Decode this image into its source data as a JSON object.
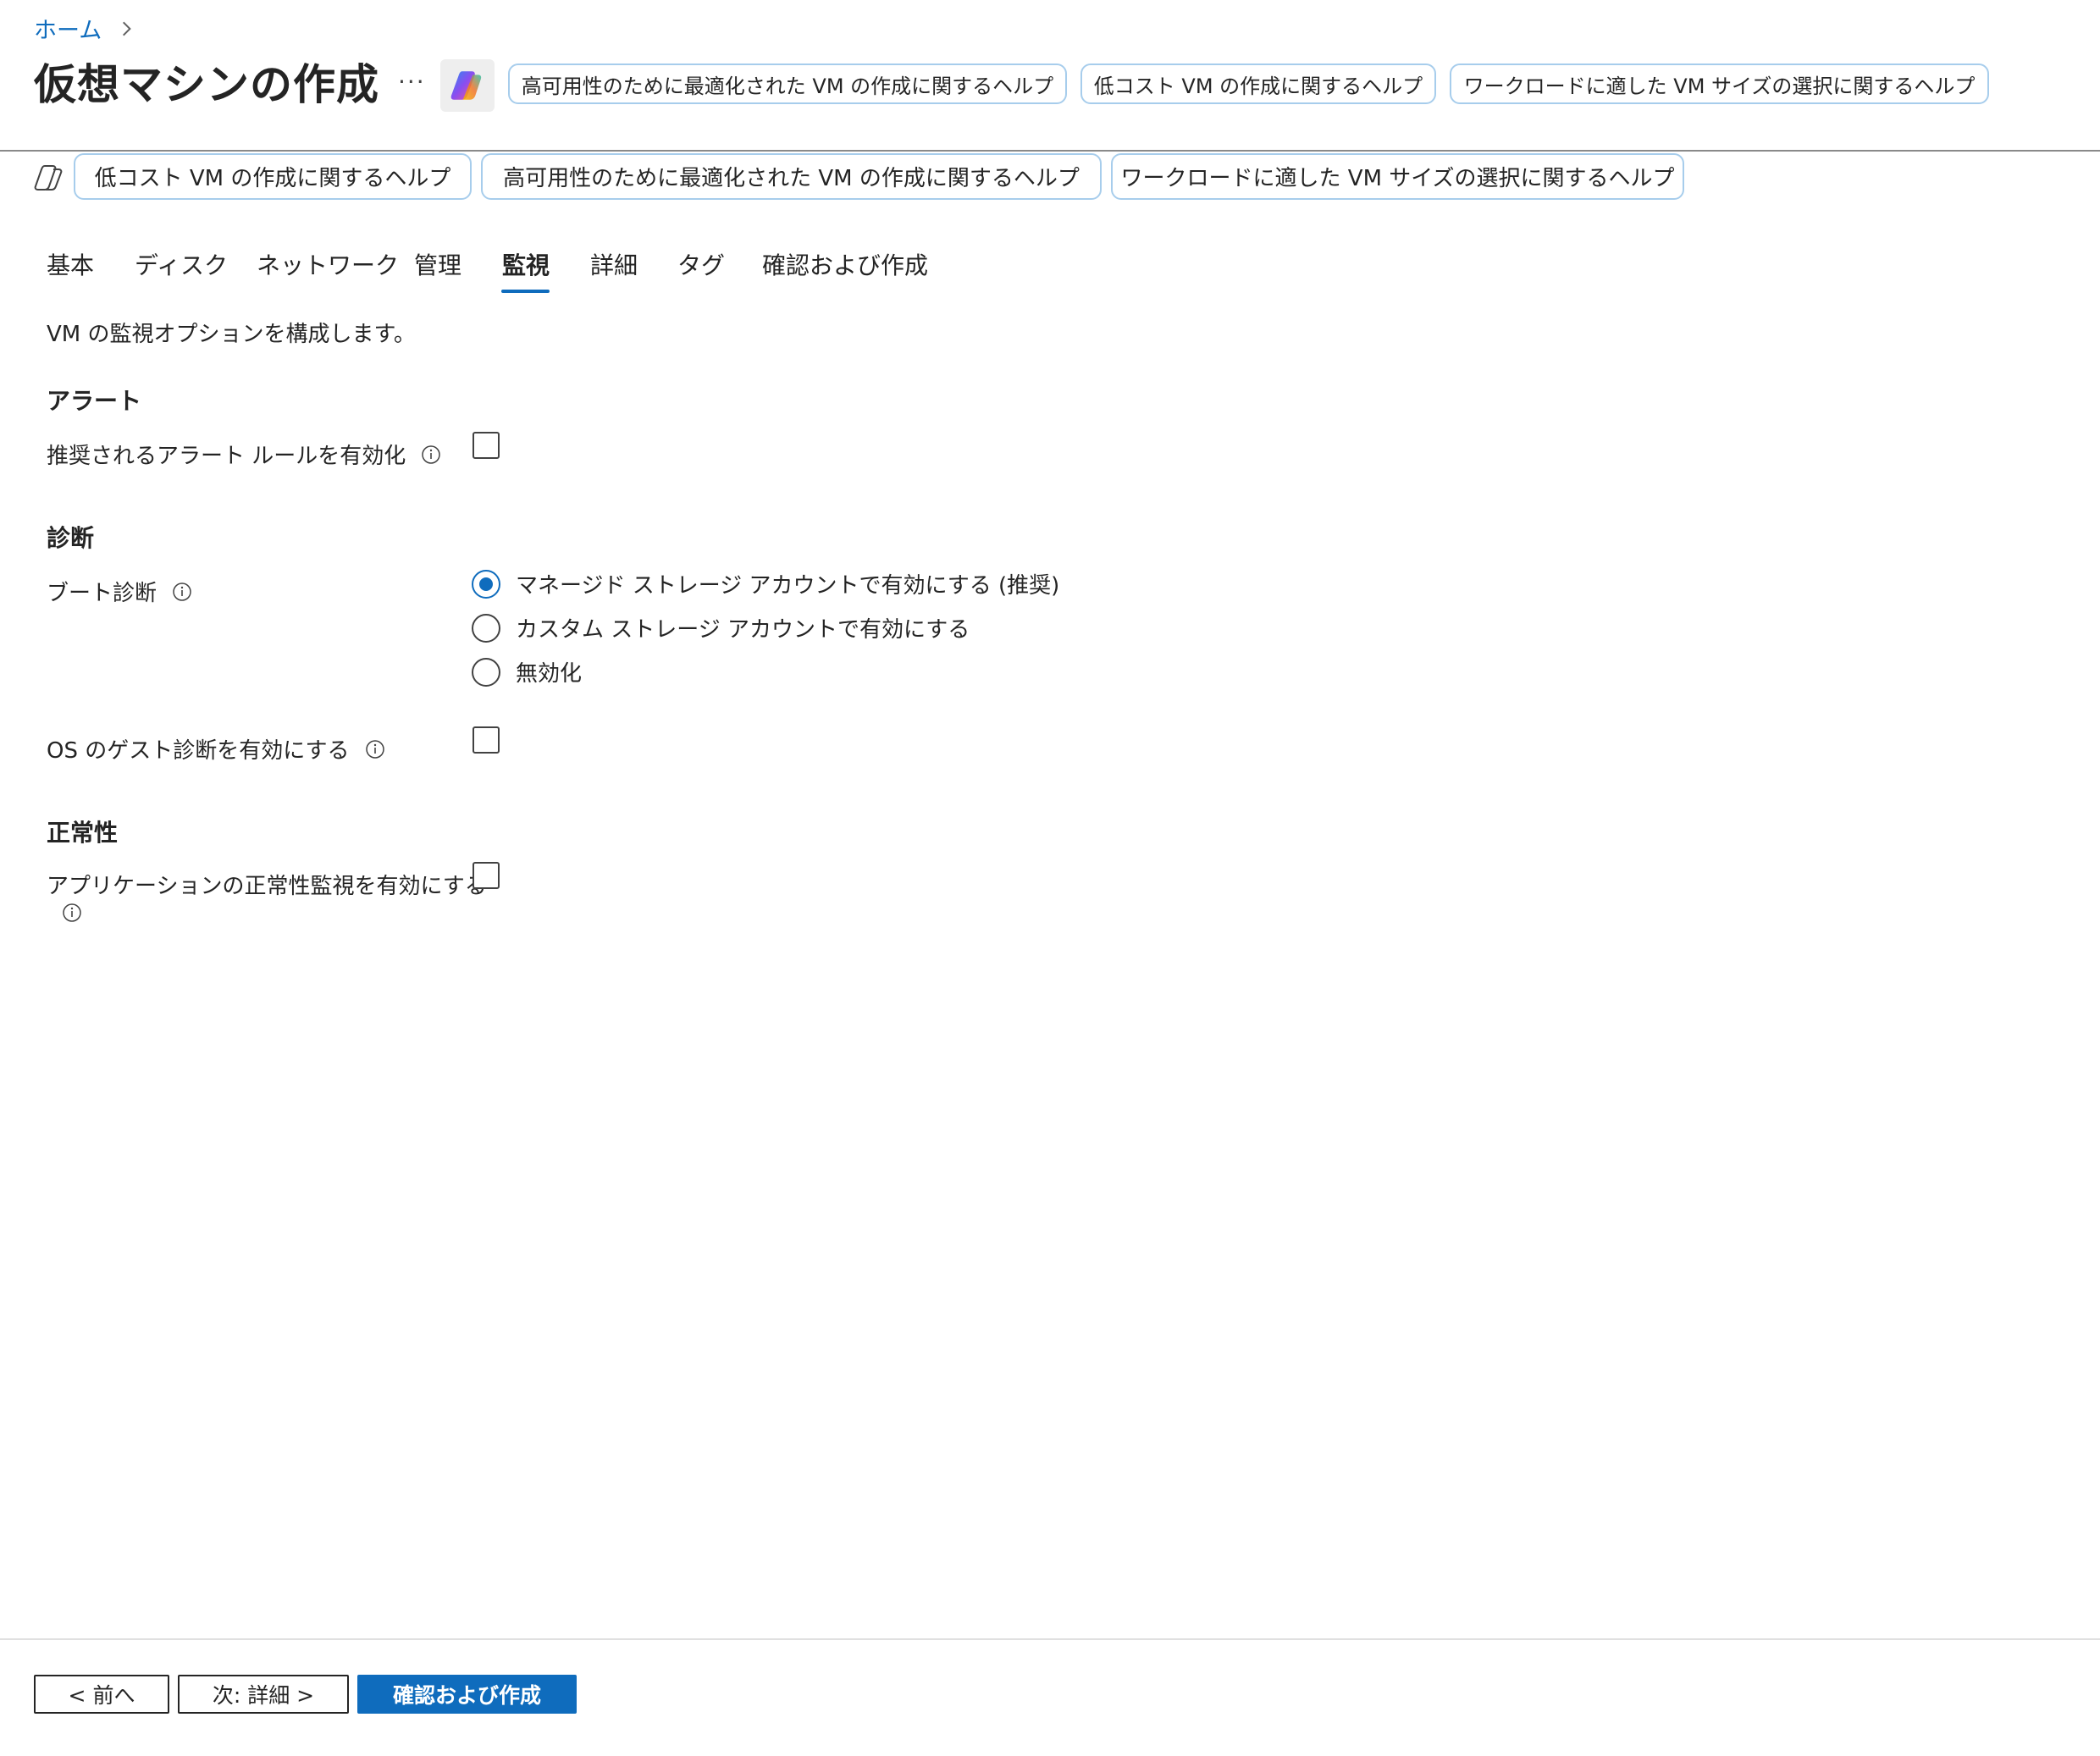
{
  "breadcrumb": {
    "home": "ホーム"
  },
  "header": {
    "title": "仮想マシンの作成",
    "more": "···",
    "suggestions": [
      "高可用性のために最適化された VM の作成に関するヘルプ",
      "低コスト VM の作成に関するヘルプ",
      "ワークロードに適した VM サイズの選択に関するヘルプ"
    ]
  },
  "copilot_bar": {
    "suggestions": [
      "低コスト VM の作成に関するヘルプ",
      "高可用性のために最適化された VM の作成に関するヘルプ",
      "ワークロードに適した VM サイズの選択に関するヘルプ"
    ]
  },
  "tabs": [
    {
      "label": "基本"
    },
    {
      "label": "ディスク"
    },
    {
      "label": "ネットワーク"
    },
    {
      "label": "管理"
    },
    {
      "label": "監視",
      "active": true
    },
    {
      "label": "詳細"
    },
    {
      "label": "タグ"
    },
    {
      "label": "確認および作成"
    }
  ],
  "main": {
    "description": "VM の監視オプションを構成します。",
    "alerts": {
      "heading": "アラート",
      "recommended_rules_label": "推奨されるアラート ルールを有効化",
      "recommended_rules_checked": false
    },
    "diagnostics": {
      "heading": "診断",
      "boot_label": "ブート診断",
      "boot_options": [
        "マネージド ストレージ アカウントで有効にする (推奨)",
        "カスタム ストレージ アカウントで有効にする",
        "無効化"
      ],
      "boot_selected": 0,
      "guest_os_label": "OS のゲスト診断を有効にする",
      "guest_os_checked": false
    },
    "health": {
      "heading": "正常性",
      "app_health_label": "アプリケーションの正常性監視を有効にする",
      "app_health_checked": false
    }
  },
  "footer": {
    "prev": "< 前へ",
    "next": "次: 詳細 >",
    "review_create": "確認および作成"
  },
  "colors": {
    "accent": "#0f6cbd",
    "pill_border": "#a7cdec",
    "text": "#242424"
  }
}
